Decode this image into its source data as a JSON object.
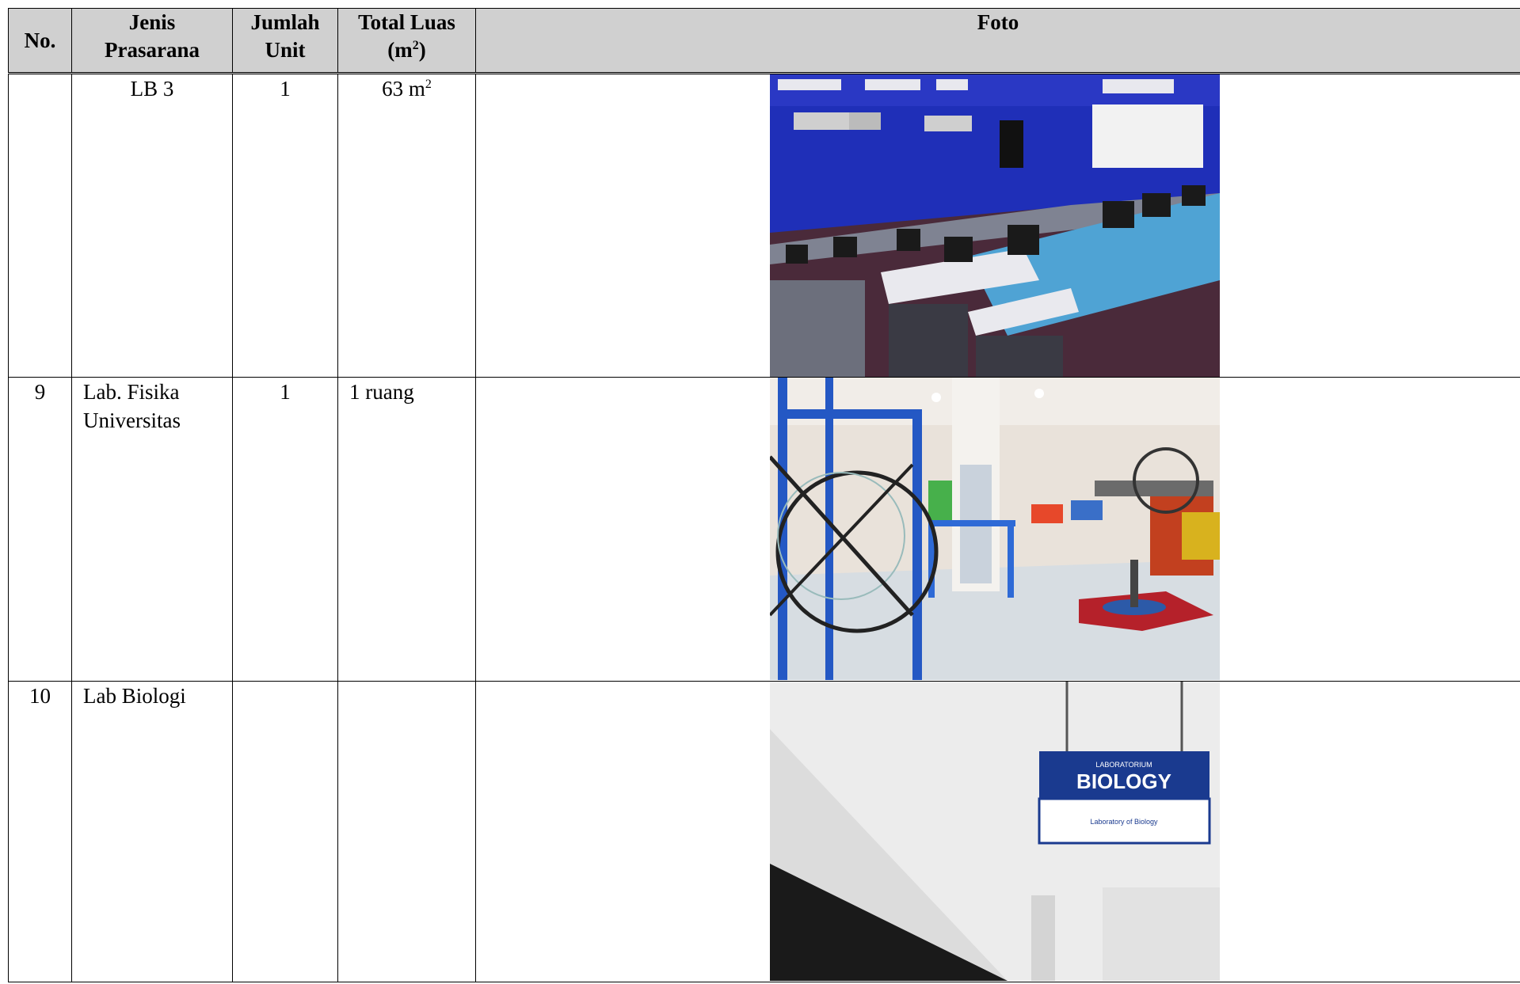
{
  "headers": {
    "no": "No.",
    "jenis_1": "Jenis",
    "jenis_2": "Prasarana",
    "jumlah_1": "Jumlah",
    "jumlah_2": "Unit",
    "luas_1": "Total Luas",
    "luas_unit": "(m",
    "luas_sup": "2",
    "luas_close": ")",
    "foto": "Foto"
  },
  "rows": [
    {
      "no": "",
      "jenis_1": "LB 3",
      "jenis_2": "",
      "jumlah": "1",
      "luas": "63 m",
      "luas_sup": "2",
      "photo": "computer-lab-photo"
    },
    {
      "no": "9",
      "jenis_1": "Lab. Fisika",
      "jenis_2": "Universitas",
      "jumlah": "1",
      "luas": "1 ruang",
      "luas_sup": "",
      "photo": "physics-lab-photo"
    },
    {
      "no": "10",
      "jenis_1": "Lab Biologi",
      "jenis_2": "",
      "jumlah": "",
      "luas": "",
      "luas_sup": "",
      "photo": "biology-lab-photo",
      "sign": {
        "line1": "LABORATORIUM",
        "line2": "BIOLOGY",
        "line3": "Laboratory of Biology"
      }
    }
  ],
  "colors": {
    "header_bg": "#d0d0d0",
    "lab_wall_blue": "#1f2fb8",
    "sign_blue": "#1a3a8f"
  }
}
